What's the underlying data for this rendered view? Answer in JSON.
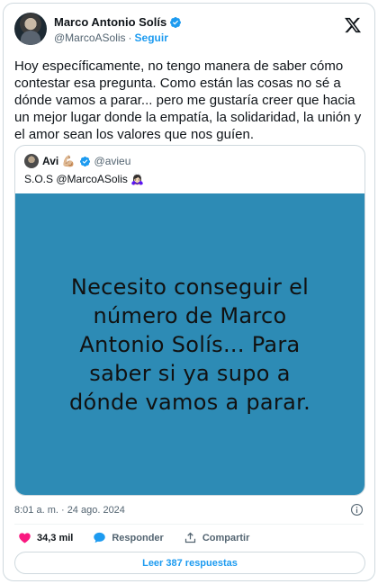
{
  "author": {
    "name": "Marco Antonio Solís",
    "handle": "@MarcoASolis",
    "separator": "·",
    "follow_label": "Seguir"
  },
  "tweet": {
    "text": "Hoy específicamente, no tengo manera de saber cómo contestar esa pregunta. Como están las cosas no sé a dónde vamos a parar... pero me gustaría creer que hacia un mejor lugar donde la empatía, la solidaridad, la unión y el amor sean los valores que nos guíen."
  },
  "quote": {
    "name": "Avi 💪🏼",
    "handle": "@avieu",
    "text": "S.O.S @MarcoASolis 🙇🏻‍♀️",
    "image_text": "Necesito conseguir el número de Marco Antonio Solís... Para saber si ya supo a dónde vamos a parar."
  },
  "meta": {
    "timestamp": "8:01 a. m. · 24 ago. 2024"
  },
  "actions": {
    "likes": "34,3 mil",
    "reply_label": "Responder",
    "share_label": "Compartir"
  },
  "replies_button": "Leer 387 respuestas",
  "colors": {
    "accent": "#1d9bf0",
    "like": "#f91880",
    "image_bg": "#2d8bb5"
  }
}
